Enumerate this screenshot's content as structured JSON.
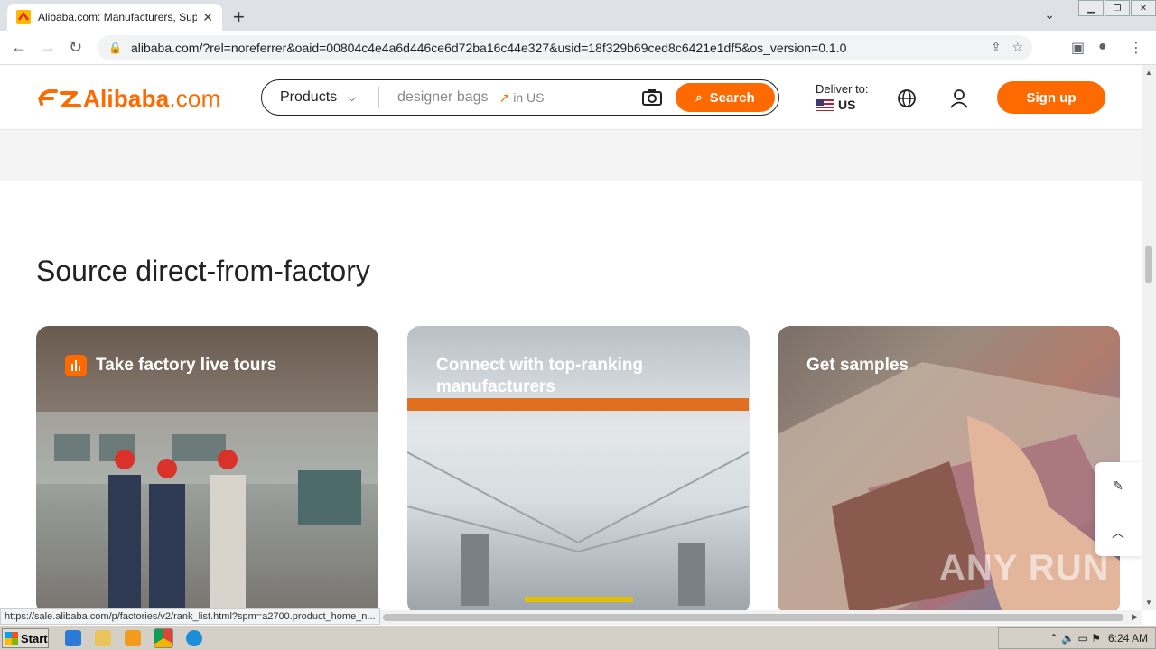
{
  "browser": {
    "tab_title": "Alibaba.com: Manufacturers, Suppliers...",
    "url": "alibaba.com/?rel=noreferrer&oaid=00804c4e4a6d446ce6d72ba16c44e327&usid=18f329b69ced8c6421e1df5&os_version=0.1.0",
    "status_url": "https://sale.alibaba.com/p/factories/v2/rank_list.html?spm=a2700.product_home_n..."
  },
  "header": {
    "logo_text": "Alibaba",
    "logo_suffix": ".com",
    "search_category": "Products",
    "search_placeholder": "designer bags",
    "search_trend_suffix": "in US",
    "search_button": "Search",
    "deliver_label": "Deliver to:",
    "deliver_country": "US",
    "signup_button": "Sign up"
  },
  "section": {
    "title": "Source direct-from-factory",
    "cards": [
      {
        "label": "Take factory live tours"
      },
      {
        "label": "Connect with top-ranking manufacturers"
      },
      {
        "label": "Get samples"
      }
    ]
  },
  "watermark": "ANY RUN",
  "taskbar": {
    "start_label": "Start",
    "clock": "6:24 AM"
  },
  "colors": {
    "brand": "#ff6a00"
  }
}
